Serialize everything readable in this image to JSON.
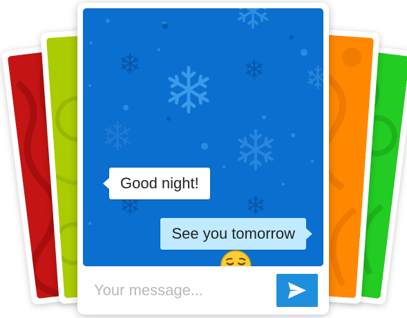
{
  "colors": {
    "card_red": "#c41414",
    "card_lime": "#aacc00",
    "card_orange": "#ff8800",
    "card_green": "#22cc22",
    "chat_background": "#0a6fcf",
    "incoming_bubble": "#ffffff",
    "outgoing_bubble": "#bfeaff",
    "send_button": "#1e8fdd"
  },
  "chat": {
    "messages": [
      {
        "direction": "incoming",
        "text": "Good night!"
      },
      {
        "direction": "outgoing",
        "text": "See you tomorrow",
        "emoji": "relieved-face-icon"
      }
    ]
  },
  "composer": {
    "placeholder": "Your message...",
    "value": "",
    "send_icon": "send-icon"
  },
  "background_icons": [
    "snowflake-icon"
  ]
}
